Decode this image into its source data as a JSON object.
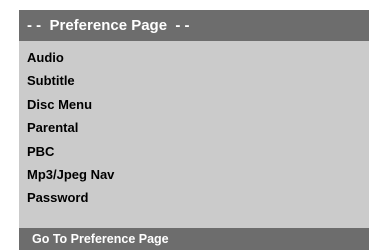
{
  "header": {
    "title": "- -  Preference Page  - -"
  },
  "menu": {
    "items": [
      {
        "label": "Audio"
      },
      {
        "label": "Subtitle"
      },
      {
        "label": "Disc Menu"
      },
      {
        "label": "Parental"
      },
      {
        "label": "PBC"
      },
      {
        "label": "Mp3/Jpeg Nav"
      },
      {
        "label": "Password"
      }
    ]
  },
  "footer": {
    "label": "Go To Preference Page"
  },
  "colors": {
    "panel_bg": "#cbcbcb",
    "bar_bg": "#6d6d6d",
    "bar_text": "#ffffff",
    "item_text": "#000000"
  }
}
